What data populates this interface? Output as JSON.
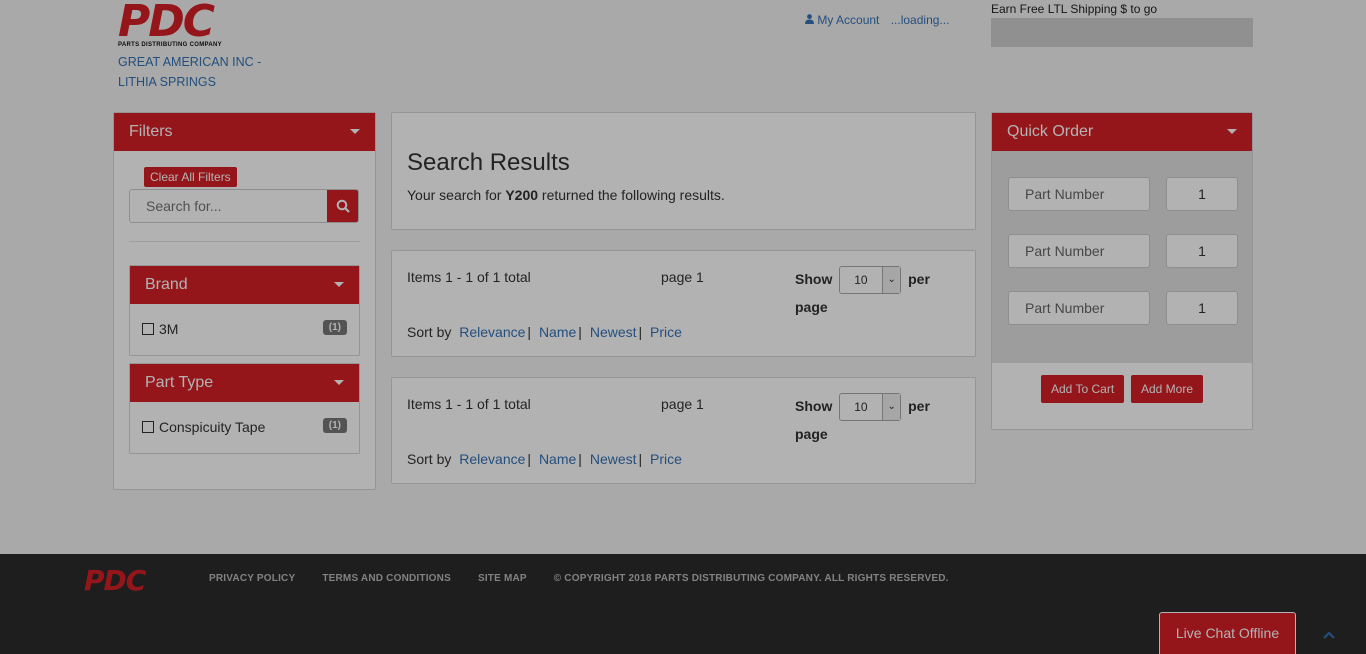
{
  "header": {
    "logo_text": "PDC",
    "logo_sub": "PARTS DISTRIBUTING COMPANY",
    "company_line1": "GREAT AMERICAN INC -",
    "company_line2": "LITHIA SPRINGS",
    "my_account": "My Account",
    "loading": "...loading...",
    "shipping_text": "Earn Free LTL Shipping $ to go"
  },
  "filters": {
    "title": "Filters",
    "clear_label": "Clear All Filters",
    "search_placeholder": "Search for...",
    "brand": {
      "title": "Brand",
      "items": [
        {
          "label": "3M",
          "count": "(1)"
        }
      ]
    },
    "part_type": {
      "title": "Part Type",
      "items": [
        {
          "label": "Conspicuity Tape",
          "count": "(1)"
        }
      ]
    }
  },
  "results": {
    "title": "Search Results",
    "desc_prefix": "Your search for ",
    "query": "Y200",
    "desc_suffix": " returned the following results."
  },
  "pager": {
    "items_text": "Items 1 - 1 of 1 total",
    "page_text": "page 1",
    "show_label": "Show",
    "per_page_value": "10",
    "per_label": "per",
    "page_label": "page",
    "sort_label": "Sort by",
    "sort_options": [
      "Relevance",
      "Name",
      "Newest",
      "Price"
    ]
  },
  "quick_order": {
    "title": "Quick Order",
    "part_placeholder": "Part Number",
    "qty_value": "1",
    "add_to_cart": "Add To Cart",
    "add_more": "Add More"
  },
  "footer": {
    "logo_text": "PDC",
    "links": [
      "PRIVACY POLICY",
      "TERMS AND CONDITIONS",
      "SITE MAP"
    ],
    "copyright": "© COPYRIGHT 2018 PARTS DISTRIBUTING COMPANY. ALL RIGHTS RESERVED.",
    "chat_label": "Live Chat Offline"
  }
}
